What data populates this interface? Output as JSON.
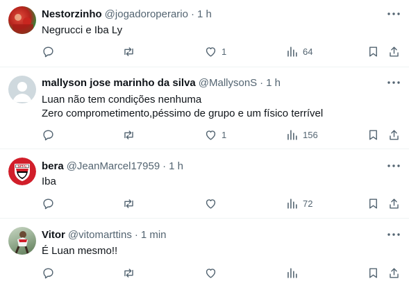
{
  "colors": {
    "text": "#0f1419",
    "secondary": "#536471",
    "divider": "#eff3f4",
    "background": "#ffffff"
  },
  "icons": [
    "more-icon",
    "reply-icon",
    "retweet-icon",
    "like-icon",
    "views-icon",
    "bookmark-icon",
    "share-icon"
  ],
  "tweets": [
    {
      "name": "Nestorzinho",
      "handle": "@jogadoroperario",
      "dot": "·",
      "time": "1 h",
      "text": "Negrucci e Iba Ly",
      "likes": "1",
      "views": "64"
    },
    {
      "name": "mallyson jose marinho da silva",
      "handle": "@MallysonS",
      "dot": "·",
      "time": "1 h",
      "text": "Luan não tem condições nenhuma\nZero comprometimento,péssimo de grupo e um físico terrível",
      "likes": "1",
      "views": "156"
    },
    {
      "name": "bera",
      "handle": "@JeanMarcel17959",
      "dot": "·",
      "time": "1 h",
      "text": "Iba",
      "likes": "",
      "views": "72",
      "avatar_badge": "SPFC"
    },
    {
      "name": "Vitor",
      "handle": "@vitomarttins",
      "dot": "·",
      "time": "1 min",
      "text": "É Luan mesmo!!",
      "likes": "",
      "views": ""
    }
  ]
}
